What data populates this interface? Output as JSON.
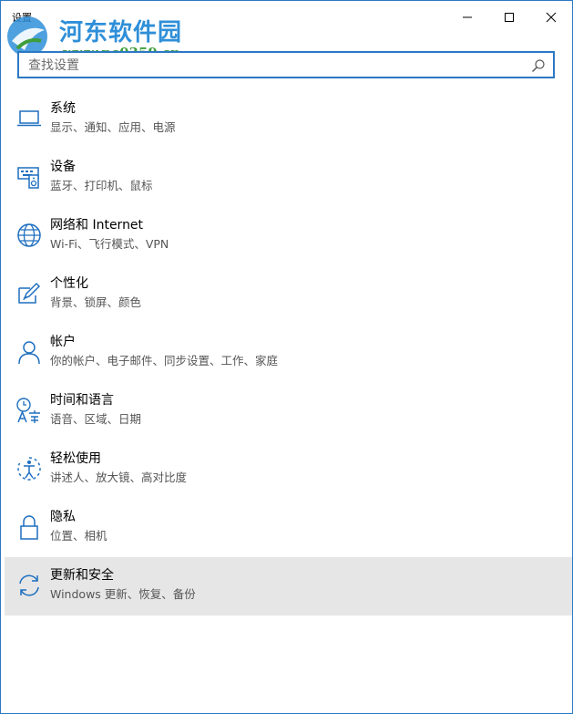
{
  "window": {
    "title": "设置",
    "minimize_icon": "minimize-icon",
    "maximize_icon": "maximize-icon",
    "close_icon": "close-icon"
  },
  "watermark": {
    "name": "河东软件园",
    "url": "www.pc0359.cn"
  },
  "search": {
    "placeholder": "查找设置",
    "value": ""
  },
  "accent_color": "#2b78c5",
  "categories": [
    {
      "title": "系统",
      "subtitle": "显示、通知、应用、电源",
      "icon": "laptop-icon"
    },
    {
      "title": "设备",
      "subtitle": "蓝牙、打印机、鼠标",
      "icon": "devices-icon"
    },
    {
      "title": "网络和 Internet",
      "subtitle": "Wi-Fi、飞行模式、VPN",
      "icon": "globe-icon"
    },
    {
      "title": "个性化",
      "subtitle": "背景、锁屏、颜色",
      "icon": "personalization-icon"
    },
    {
      "title": "帐户",
      "subtitle": "你的帐户、电子邮件、同步设置、工作、家庭",
      "icon": "person-icon"
    },
    {
      "title": "时间和语言",
      "subtitle": "语音、区域、日期",
      "icon": "time-language-icon"
    },
    {
      "title": "轻松使用",
      "subtitle": "讲述人、放大镜、高对比度",
      "icon": "ease-of-access-icon"
    },
    {
      "title": "隐私",
      "subtitle": "位置、相机",
      "icon": "lock-icon"
    },
    {
      "title": "更新和安全",
      "subtitle": "Windows 更新、恢复、备份",
      "icon": "sync-icon",
      "selected": true
    }
  ]
}
